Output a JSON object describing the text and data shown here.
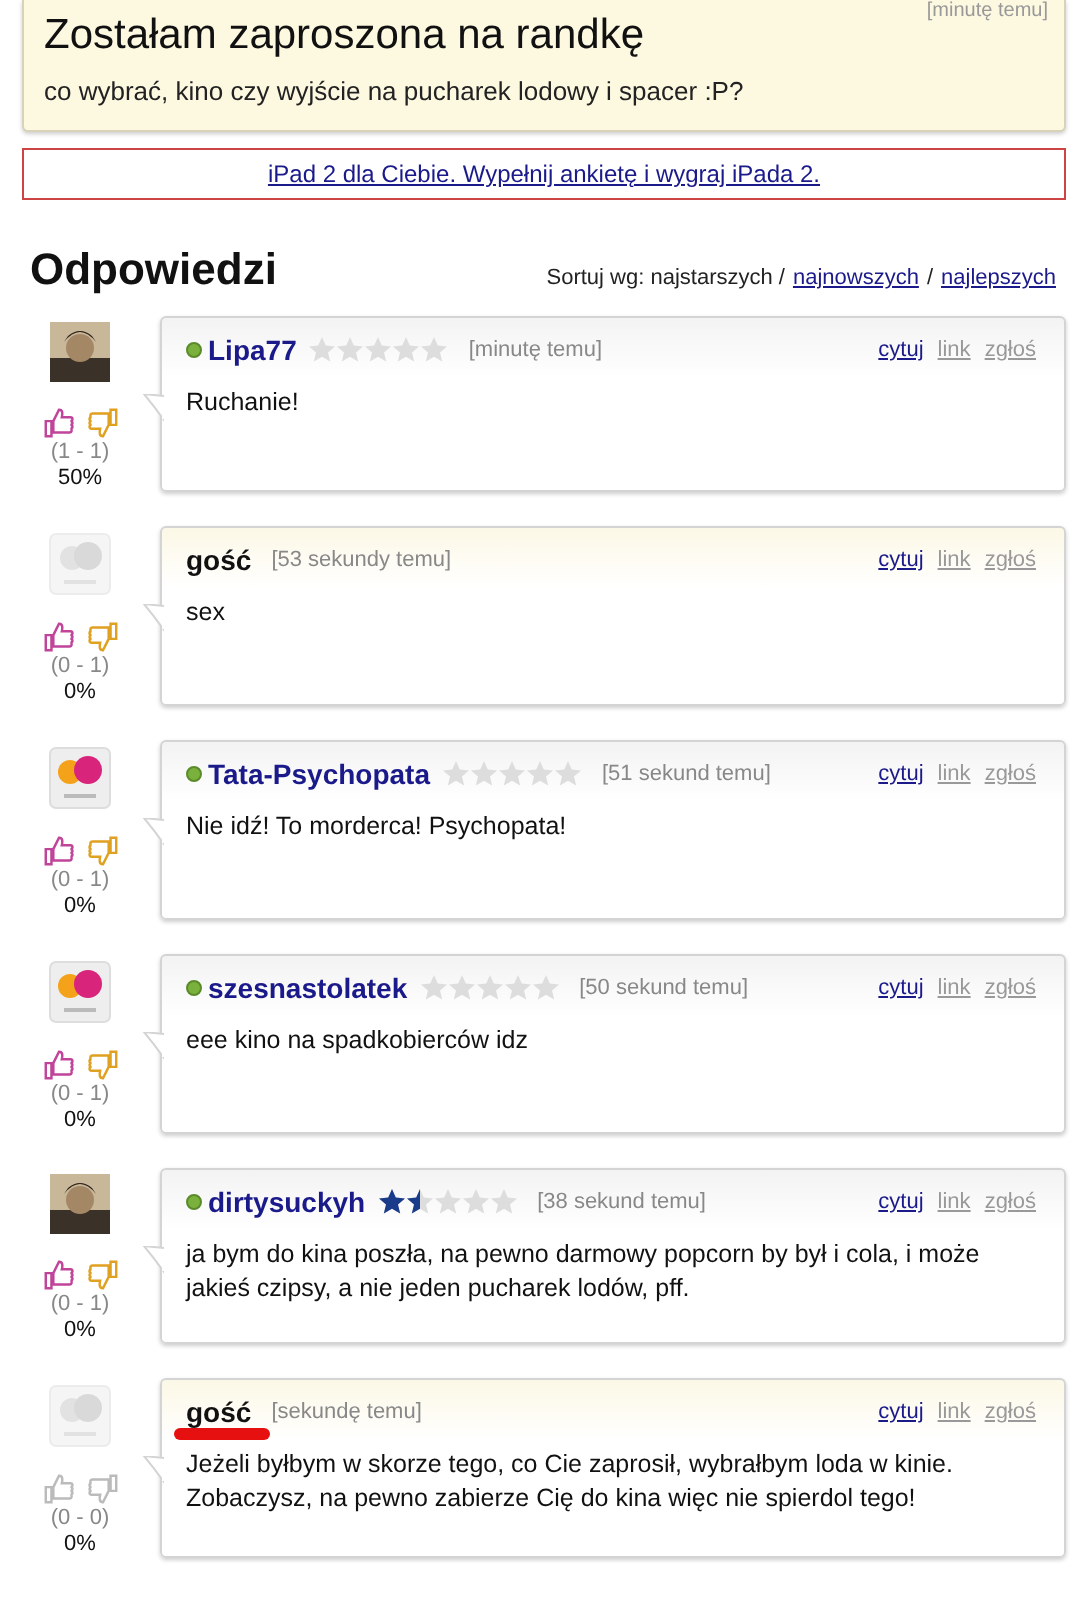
{
  "question": {
    "time": "[minutę temu]",
    "title": "Zostałam zaproszona na randkę",
    "body": "co wybrać, kino czy wyjście na pucharek lodowy i spacer :P?"
  },
  "ad": {
    "link": "iPad 2 dla Ciebie. Wypełnij ankietę i wygraj iPada 2."
  },
  "answers_header": {
    "title": "Odpowiedzi",
    "sort_label": "Sortuj wg: najstarszych /",
    "sort_links": [
      "najnowszych",
      "najlepszych"
    ],
    "sort_separator": "/"
  },
  "answers": [
    {
      "kind": "user",
      "name": "Lipa77",
      "online": true,
      "stars": 0,
      "time": "[minutę temu]",
      "body": "Ruchanie!",
      "votes_active": true,
      "votes": "(1 - 1)",
      "percent": "50%",
      "actions": [
        "cytuj",
        "link",
        "zgłoś"
      ]
    },
    {
      "kind": "guest",
      "avatar": {
        "kind": "anon"
      },
      "name": "gość",
      "time": "[53 sekundy temu]",
      "body": "sex",
      "votes_active": true,
      "votes": "(0 - 1)",
      "percent": "0%",
      "actions": [
        "cytuj",
        "link",
        "zgłoś"
      ]
    },
    {
      "kind": "user",
      "avatar": {
        "kind": "logo"
      },
      "name": "Tata-Psychopata",
      "online": true,
      "stars": 0,
      "time": "[51 sekund temu]",
      "body": "Nie idź! To morderca! Psychopata!",
      "votes_active": true,
      "votes": "(0 - 1)",
      "percent": "0%",
      "actions": [
        "cytuj",
        "link",
        "zgłoś"
      ]
    },
    {
      "kind": "user",
      "avatar": {
        "kind": "logo"
      },
      "name": "szesnastolatek",
      "online": true,
      "stars": 0,
      "time": "[50 sekund temu]",
      "body": "eee kino na spadkobierców idz",
      "votes_active": true,
      "votes": "(0 - 1)",
      "percent": "0%",
      "actions": [
        "cytuj",
        "link",
        "zgłoś"
      ]
    },
    {
      "kind": "user",
      "name": "dirtysuckyh",
      "online": true,
      "stars": 1.5,
      "time": "[38 sekund temu]",
      "body": "ja bym do kina poszła, na pewno darmowy popcorn by był i cola, i może jakieś czipsy, a nie jeden pucharek lodów, pff.",
      "votes_active": true,
      "votes": "(0 - 1)",
      "percent": "0%",
      "actions": [
        "cytuj",
        "link",
        "zgłoś"
      ]
    },
    {
      "kind": "guest",
      "avatar": {
        "kind": "anon"
      },
      "name": "gość",
      "time": "[sekundę temu]",
      "body": "Jeżeli byłbym w skorze tego, co Cie zaprosił, wybrałbym loda w kinie. Zobaczysz, na pewno zabierze Cię do kina więc nie spierdol tego!",
      "votes_active": false,
      "votes": "(0 - 0)",
      "percent": "0%",
      "underlined": true,
      "actions": [
        "cytuj",
        "link",
        "zgłoś"
      ]
    }
  ]
}
